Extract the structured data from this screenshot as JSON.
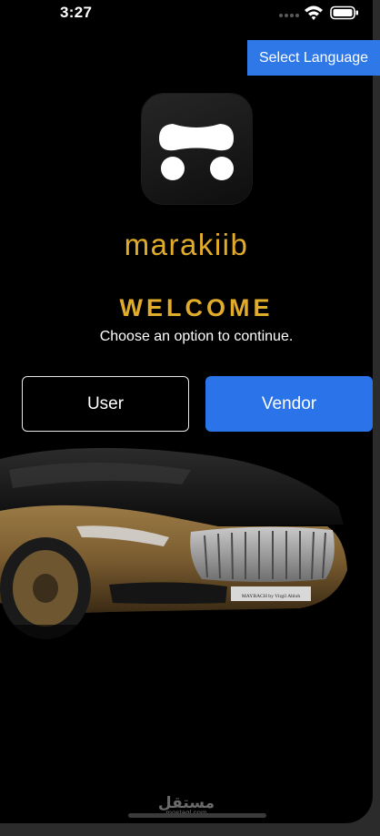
{
  "status_bar": {
    "time": "3:27",
    "icons": [
      "signal-dots-icon",
      "wifi-icon",
      "battery-icon"
    ]
  },
  "language_button": {
    "label": "Select Language"
  },
  "logo": {
    "icon": "car-face-logo-icon"
  },
  "brand": {
    "name": "marakiib"
  },
  "welcome": {
    "title": "WELCOME",
    "subtitle": "Choose an option to continue."
  },
  "options": {
    "user_label": "User",
    "vendor_label": "Vendor"
  },
  "car_image": {
    "plate_text": "MAYBACH by Virgil Abloh"
  },
  "watermark": {
    "text": "مستقل",
    "subtext": "mostaql.com"
  },
  "colors": {
    "background": "#000000",
    "accent_gold": "#e2ac2b",
    "primary_blue": "#2a73e8",
    "language_blue": "#2f78e8",
    "text": "#ffffff"
  }
}
